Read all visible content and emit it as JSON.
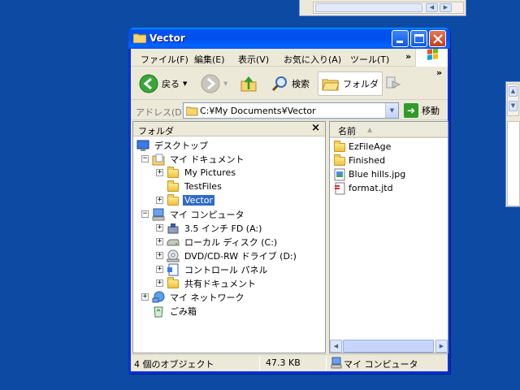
{
  "window": {
    "title": "Vector"
  },
  "menu": [
    "ファイル(F)",
    "編集(E)",
    "表示(V)",
    "お気に入り(A)",
    "ツール(T)"
  ],
  "menu_more": "»",
  "toolbar": {
    "back": "戻る",
    "search": "検索",
    "folders": "フォルダ",
    "more": "»"
  },
  "address": {
    "label": "アドレス(D)",
    "value": "C:¥My Documents¥Vector",
    "go": "移動"
  },
  "folder_pane": {
    "title": "フォルダ",
    "close": "×",
    "tree": [
      {
        "label": "デスクトップ",
        "icon": "desktop-icon",
        "expander": ""
      },
      {
        "label": "マイ ドキュメント",
        "icon": "my-documents-icon",
        "expander": "−"
      },
      {
        "label": "My Pictures",
        "icon": "folder-icon",
        "expander": "+"
      },
      {
        "label": "TestFiles",
        "icon": "folder-icon",
        "expander": ""
      },
      {
        "label": "Vector",
        "icon": "folder-icon",
        "expander": "+",
        "selected": true
      },
      {
        "label": "マイ コンピュータ",
        "icon": "my-computer-icon",
        "expander": "−"
      },
      {
        "label": "3.5 インチ FD (A:)",
        "icon": "floppy-icon",
        "expander": "+"
      },
      {
        "label": "ローカル ディスク (C:)",
        "icon": "hard-disk-icon",
        "expander": "+"
      },
      {
        "label": "DVD/CD-RW ドライブ (D:)",
        "icon": "dvd-drive-icon",
        "expander": "+"
      },
      {
        "label": "コントロール パネル",
        "icon": "control-panel-icon",
        "expander": "+"
      },
      {
        "label": "共有ドキュメント",
        "icon": "folder-icon",
        "expander": "+"
      },
      {
        "label": "マイ ネットワーク",
        "icon": "my-network-icon",
        "expander": "+"
      },
      {
        "label": "ごみ箱",
        "icon": "recycle-bin-icon",
        "expander": ""
      }
    ]
  },
  "file_pane": {
    "column": "名前",
    "files": [
      {
        "name": "EzFileAge",
        "icon": "folder-icon"
      },
      {
        "name": "Finished",
        "icon": "folder-icon"
      },
      {
        "name": "Blue hills.jpg",
        "icon": "image-file-icon"
      },
      {
        "name": "format.jtd",
        "icon": "document-file-icon"
      }
    ]
  },
  "status": {
    "objects": "4 個のオブジェクト",
    "size": "47.3 KB",
    "location": "マイ コンピュータ"
  },
  "colors": {
    "desktop": "#0c4aa3",
    "titlebar": "#0053ee",
    "selection": "#316ac5",
    "window_face": "#ece9d8"
  }
}
